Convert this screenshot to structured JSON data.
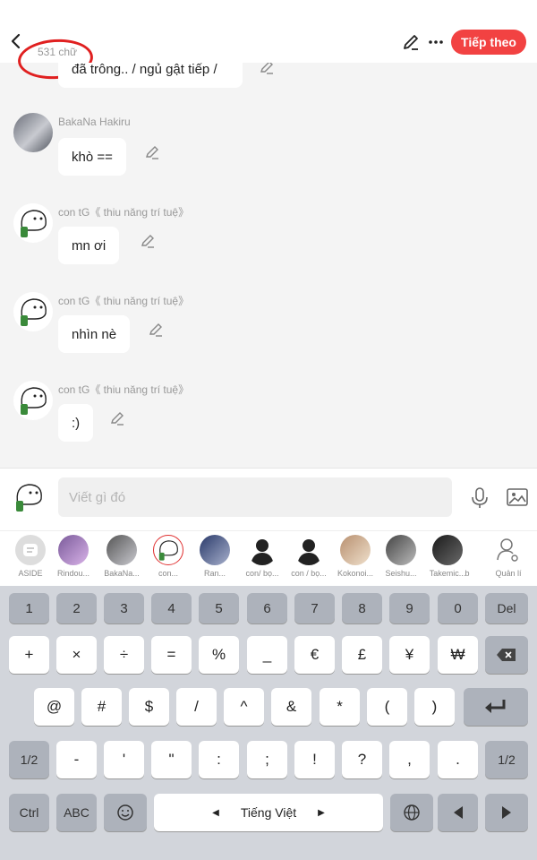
{
  "header": {
    "word_count": "531 chữ",
    "follow_label": "Tiếp theo"
  },
  "messages": [
    {
      "name": "",
      "text": "đã trông.. / ngủ gật tiếp /"
    },
    {
      "name": "BakaNa Hakiru",
      "text": "khò =="
    },
    {
      "name": "con tG《 thiu năng trí tuệ》",
      "text": "mn ơi"
    },
    {
      "name": "con tG《 thiu năng trí tuệ》",
      "text": "nhìn nè"
    },
    {
      "name": "con tG《 thiu năng trí tuệ》",
      "text": ":)"
    }
  ],
  "input": {
    "placeholder": "Viết gì đó"
  },
  "characters": [
    {
      "label": "ASIDE"
    },
    {
      "label": "Rindou..."
    },
    {
      "label": "BakaNa..."
    },
    {
      "label": "con..."
    },
    {
      "label": "Ran..."
    },
    {
      "label": "con/ bọ..."
    },
    {
      "label": "con / bọ..."
    },
    {
      "label": "Kokonoi..."
    },
    {
      "label": "Seishu..."
    },
    {
      "label": "Takemic..."
    },
    {
      "label": "b"
    },
    {
      "label": "Quản lí"
    }
  ],
  "keyboard": {
    "row1": [
      "1",
      "2",
      "3",
      "4",
      "5",
      "6",
      "7",
      "8",
      "9",
      "0",
      "Del"
    ],
    "row2": [
      "+",
      "×",
      "÷",
      "=",
      "%",
      "_",
      "€",
      "£",
      "¥",
      "₩"
    ],
    "row3": [
      "@",
      "#",
      "$",
      "/",
      "^",
      "&",
      "*",
      "(",
      ")"
    ],
    "row4": [
      "1/2",
      "-",
      "'",
      "\"",
      ":",
      ";",
      "!",
      "?",
      ",",
      ".",
      "1/2"
    ],
    "row5": {
      "ctrl": "Ctrl",
      "abc": "ABC",
      "space": "Tiếng Việt"
    }
  },
  "colors": {
    "accent": "#f24242",
    "annotation": "#e02020"
  }
}
